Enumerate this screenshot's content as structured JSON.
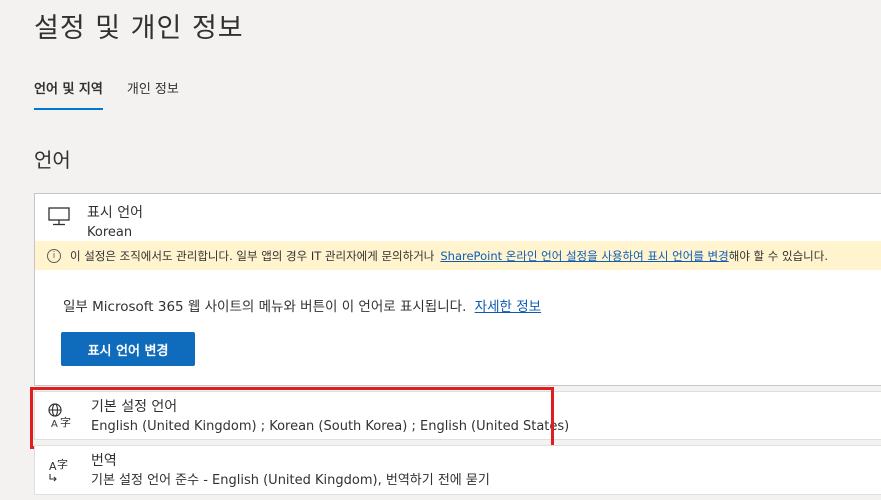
{
  "page": {
    "title": "설정 및 개인 정보"
  },
  "tabs": [
    {
      "label": "언어 및 지역"
    },
    {
      "label": "개인 정보"
    }
  ],
  "section": {
    "heading": "언어"
  },
  "display_language": {
    "title": "표시 언어",
    "value": "Korean",
    "notice_text": "이 설정은 조직에서도 관리합니다. 일부 앱의 경우 IT 관리자에게 문의하거나",
    "notice_link": "SharePoint 온라인 언어 설정을 사용하여 표시 언어를 변경",
    "notice_suffix": "해야 할 수 있습니다.",
    "description": "일부 Microsoft 365 웹 사이트의 메뉴와 버튼이 이 언어로 표시됩니다.",
    "learn_more": "자세한 정보",
    "change_button": "표시 언어 변경"
  },
  "preferred_languages": {
    "title": "기본 설정 언어",
    "value": "English (United Kingdom) ; Korean (South Korea) ; English (United States)"
  },
  "translation": {
    "title": "번역",
    "value": "기본 설정 언어 준수 - English (United Kingdom), 번역하기 전에 묻기"
  },
  "colors": {
    "accent": "#0f6cbd",
    "notice_bg": "#fff4ce",
    "highlight": "#e01e1e"
  },
  "icons": [
    "monitor-icon",
    "info-icon",
    "language-icon",
    "translate-icon"
  ]
}
